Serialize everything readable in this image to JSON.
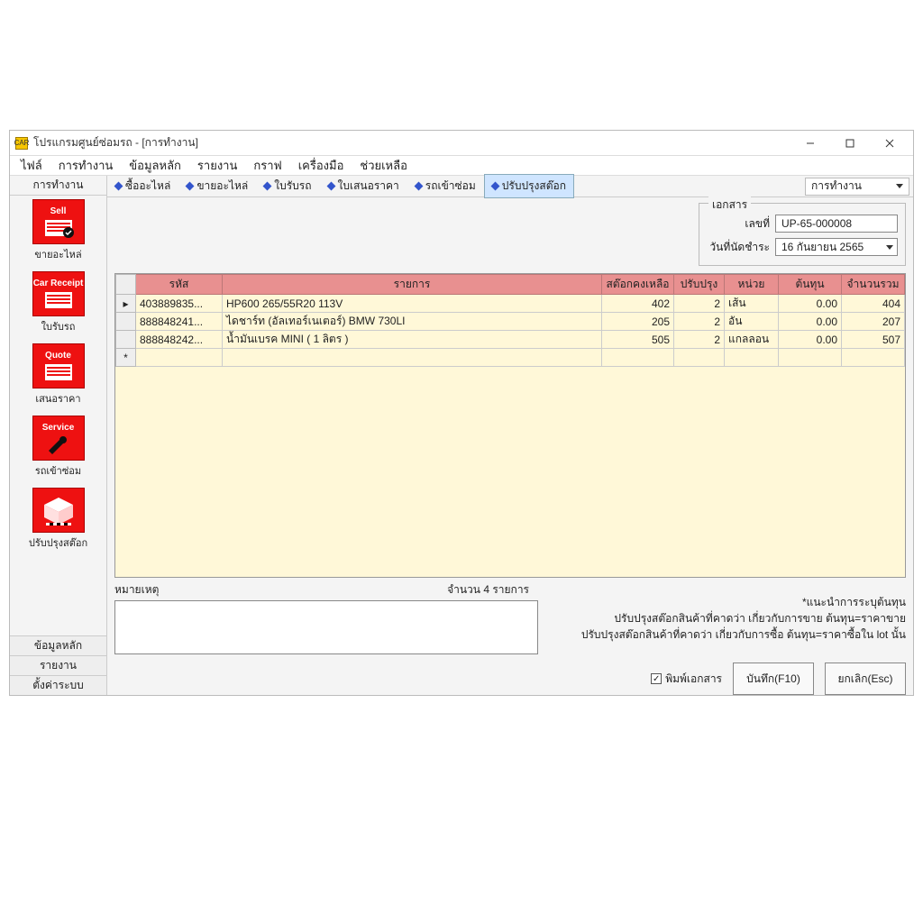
{
  "window": {
    "app_icon": "CAR",
    "title": "โปรแกรมศูนย์ซ่อมรถ - [การทำงาน]"
  },
  "menubar": [
    "ไฟล์",
    "การทำงาน",
    "ข้อมูลหลัก",
    "รายงาน",
    "กราฟ",
    "เครื่องมือ",
    "ช่วยเหลือ"
  ],
  "sidebar": {
    "title": "การทำงาน",
    "items": [
      {
        "badge": "Sell",
        "label": "ขายอะไหล่"
      },
      {
        "badge": "Car Receipt",
        "label": "ใบรับรถ"
      },
      {
        "badge": "Quote",
        "label": "เสนอราคา"
      },
      {
        "badge": "Service",
        "label": "รถเข้าซ่อม"
      },
      {
        "badge": "",
        "label": "ปรับปรุงสต๊อก"
      }
    ],
    "bottom": [
      "ข้อมูลหลัก",
      "รายงาน",
      "ตั้งค่าระบบ"
    ]
  },
  "tabs": {
    "items": [
      "ซื้ออะไหล่",
      "ขายอะไหล่",
      "ใบรับรถ",
      "ใบเสนอราคา",
      "รถเข้าซ่อม",
      "ปรับปรุงสต๊อก"
    ],
    "active_index": 5,
    "mode_select": "การทำงาน"
  },
  "document": {
    "legend": "เอกสาร",
    "no_label": "เลขที่",
    "no_value": "UP-65-000008",
    "date_label": "วันที่นัดชำระ",
    "date_value": "16  กันยายน   2565"
  },
  "table": {
    "headers": [
      "รหัส",
      "รายการ",
      "สต๊อกคงเหลือ",
      "ปรับปรุง",
      "หน่วย",
      "ต้นทุน",
      "จำนวนรวม"
    ],
    "rows": [
      {
        "marker": "▸",
        "code": "403889835...",
        "name": "HP600 265/55R20 113V",
        "stock": "402",
        "adj": "2",
        "unit": "เส้น",
        "cost": "0.00",
        "total": "404"
      },
      {
        "marker": "",
        "code": "888848241...",
        "name": "ไดชาร์ท (อัลเทอร์เนเตอร์) BMW 730LI",
        "stock": "205",
        "adj": "2",
        "unit": "อัน",
        "cost": "0.00",
        "total": "207"
      },
      {
        "marker": "",
        "code": "888848242...",
        "name": "น้ำมันเบรค MINI ( 1 ลิตร )",
        "stock": "505",
        "adj": "2",
        "unit": "แกลลอน",
        "cost": "0.00",
        "total": "507"
      }
    ],
    "new_row_marker": "*"
  },
  "remarks": {
    "label": "หมายเหตุ",
    "count": "จำนวน 4 รายการ",
    "value": ""
  },
  "info": {
    "line1": "*แนะนำการระบุต้นทุน",
    "line2": "ปรับปรุงสต๊อกสินค้าที่คาดว่า เกี่ยวกับการขาย ต้นทุน=ราคาขาย",
    "line3": "ปรับปรุงสต๊อกสินค้าที่คาดว่า เกี่ยวกับการซื้อ ต้นทุน=ราคาซื้อใน lot นั้น"
  },
  "actions": {
    "print_label": "พิมพ์เอกสาร",
    "print_checked": true,
    "save": "บันทึก(F10)",
    "cancel": "ยกเลิก(Esc)"
  }
}
